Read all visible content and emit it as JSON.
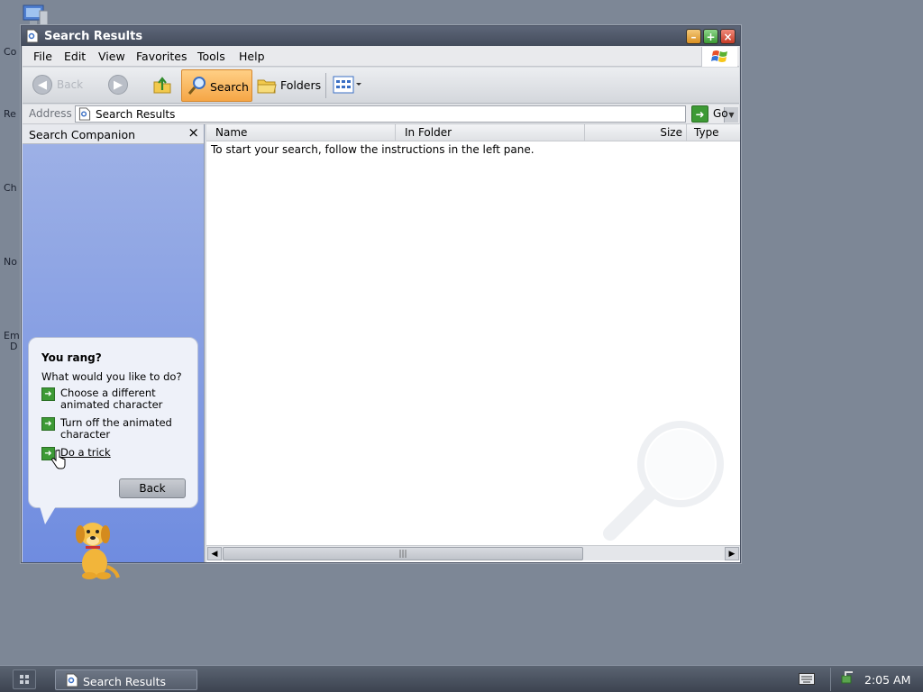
{
  "desktop": {
    "label_fragments": [
      "Co",
      "Re",
      "Ch",
      "No",
      "Em",
      "D"
    ]
  },
  "window": {
    "title": "Search Results",
    "menu": [
      "File",
      "Edit",
      "View",
      "Favorites",
      "Tools",
      "Help"
    ],
    "toolbar": {
      "back_label": "Back",
      "search_label": "Search",
      "folders_label": "Folders"
    },
    "address": {
      "label": "Address",
      "value": "Search Results",
      "go_label": "Go"
    }
  },
  "companion": {
    "title": "Search Companion",
    "close_glyph": "×",
    "balloon": {
      "title": "You rang?",
      "question": "What would you like to do?",
      "options": [
        "Choose a different animated character",
        "Turn off the animated character",
        "Do a trick"
      ],
      "back_label": "Back"
    }
  },
  "results": {
    "columns": [
      "Name",
      "In Folder",
      "Size",
      "Type"
    ],
    "message": "To start your search, follow the instructions in the left pane."
  },
  "taskbar": {
    "task_label": "Search Results",
    "clock": "2:05 AM"
  },
  "colors": {
    "desktop": "#7d8796",
    "titlebar": "#4f5768",
    "search_button": "#f5a646",
    "companion_pane": "#6f8ce0",
    "go_arrow": "#3d9a35"
  }
}
